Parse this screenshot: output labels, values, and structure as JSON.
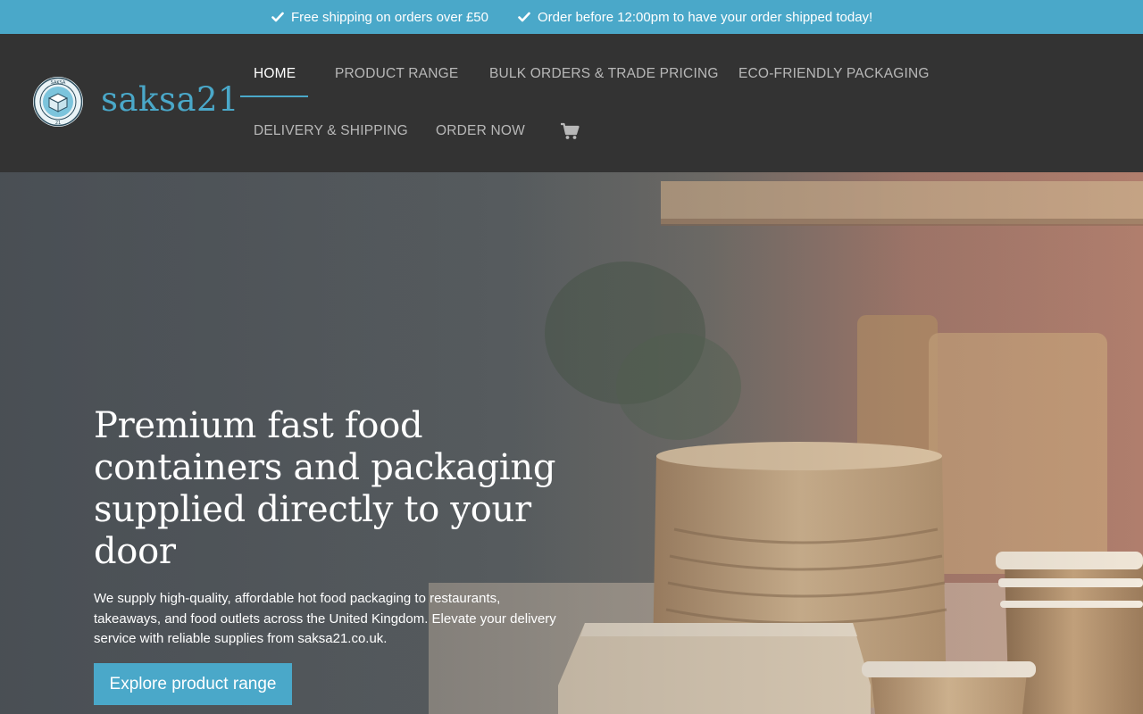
{
  "topbar": {
    "messages": [
      {
        "icon": "check-icon",
        "text": "Free shipping on orders over £50"
      },
      {
        "icon": "check-icon",
        "text": "Order before 12:00pm to have your order shipped today!"
      }
    ]
  },
  "header": {
    "logo_text": "saksa21",
    "logo_badge_letters": "SAKSA 21",
    "nav": {
      "home": "HOME",
      "product_range": "PRODUCT RANGE",
      "bulk_orders": "BULK ORDERS & TRADE PRICING",
      "eco_friendly": "ECO-FRIENDLY PACKAGING",
      "delivery": "DELIVERY & SHIPPING",
      "order_now": "ORDER NOW"
    },
    "active_nav": "home",
    "cart_icon": "cart-icon"
  },
  "hero": {
    "title": "Premium fast food containers and packaging supplied directly to your door",
    "text": "We supply high-quality, affordable hot food packaging to restaurants, takeaways, and food outlets across the United Kingdom. Elevate your delivery service with reliable supplies from saksa21.co.uk.",
    "button": "Explore product range",
    "background_image": "kraft paper food containers on kitchen counter"
  },
  "colors": {
    "accent": "#4aa8c9",
    "header_bg": "#333333",
    "nav_text": "#b8b8b8",
    "nav_active": "#ffffff"
  }
}
